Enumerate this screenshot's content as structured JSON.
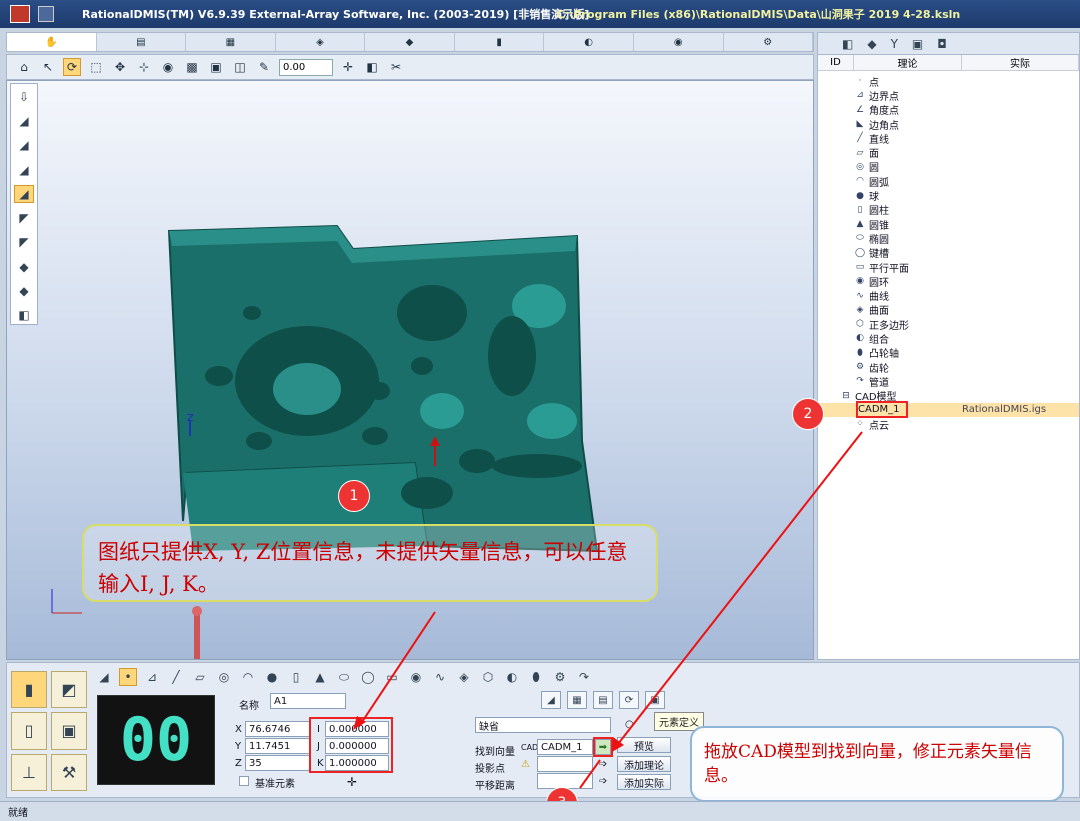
{
  "window": {
    "title": "RationalDMIS(TM) V6.9.39   External-Array Software, Inc. (2003-2019) [非销售演示版]",
    "path": "C:\\Program Files (x86)\\RationalDMIS\\Data\\山洞果子 2019 4-28.ksln"
  },
  "toolbar": {
    "zoom_value": "0.00"
  },
  "annotations": {
    "note1": "图纸只提供X, Y, Z位置信息，未提供矢量信息，可以任意输入I, J, K。",
    "badge1": "1",
    "badge2": "2",
    "badge3": "3",
    "note3": "拖放CAD模型到找到向量，修正元素矢量信息。"
  },
  "tree": {
    "columns": {
      "id": "ID",
      "theory": "理论",
      "actual": "实际"
    },
    "items": [
      {
        "label": "点",
        "icon": "point-icon"
      },
      {
        "label": "边界点",
        "icon": "edge-point-icon"
      },
      {
        "label": "角度点",
        "icon": "angle-point-icon"
      },
      {
        "label": "边角点",
        "icon": "corner-point-icon"
      },
      {
        "label": "直线",
        "icon": "line-icon"
      },
      {
        "label": "面",
        "icon": "plane-icon"
      },
      {
        "label": "圆",
        "icon": "circle-icon"
      },
      {
        "label": "圆弧",
        "icon": "arc-icon"
      },
      {
        "label": "球",
        "icon": "sphere-icon"
      },
      {
        "label": "圆柱",
        "icon": "cylinder-icon"
      },
      {
        "label": "圆锥",
        "icon": "cone-icon"
      },
      {
        "label": "椭圆",
        "icon": "ellipse-icon"
      },
      {
        "label": "键槽",
        "icon": "slot-icon"
      },
      {
        "label": "平行平面",
        "icon": "parallel-plane-icon"
      },
      {
        "label": "圆环",
        "icon": "torus-icon"
      },
      {
        "label": "曲线",
        "icon": "curve-icon"
      },
      {
        "label": "曲面",
        "icon": "surface-icon"
      },
      {
        "label": "正多边形",
        "icon": "polygon-icon"
      },
      {
        "label": "组合",
        "icon": "group-icon"
      },
      {
        "label": "凸轮轴",
        "icon": "camshaft-icon"
      },
      {
        "label": "齿轮",
        "icon": "gear-icon"
      },
      {
        "label": "管道",
        "icon": "pipe-icon"
      }
    ],
    "cad_group": "CAD模型",
    "cad_child": "CADM_1",
    "cad_child_value": "RationalDMIS.igs",
    "point_cloud": "点云"
  },
  "form": {
    "name_label": "名称",
    "name_value": "A1",
    "x_label": "X",
    "x_value": "76.6746",
    "y_label": "Y",
    "y_value": "11.7451",
    "z_label": "Z",
    "z_value": "35",
    "i_label": "I",
    "i_value": "0.000000",
    "j_label": "J",
    "j_value": "0.000000",
    "k_label": "K",
    "k_value": "1.000000",
    "datum_label": "基准元素",
    "default_select": "缺省",
    "find_vector_label": "找到向量",
    "find_vector_value": "CADM_1",
    "cad_tag": "CAD",
    "project_label": "投影点",
    "offset_label": "平移距离",
    "preview_button": "预览",
    "add_theory_button": "添加理论",
    "add_actual_button": "添加实际",
    "tooltip": "元素定义"
  },
  "display": {
    "value": "00"
  },
  "status": {
    "text": "就绪"
  }
}
